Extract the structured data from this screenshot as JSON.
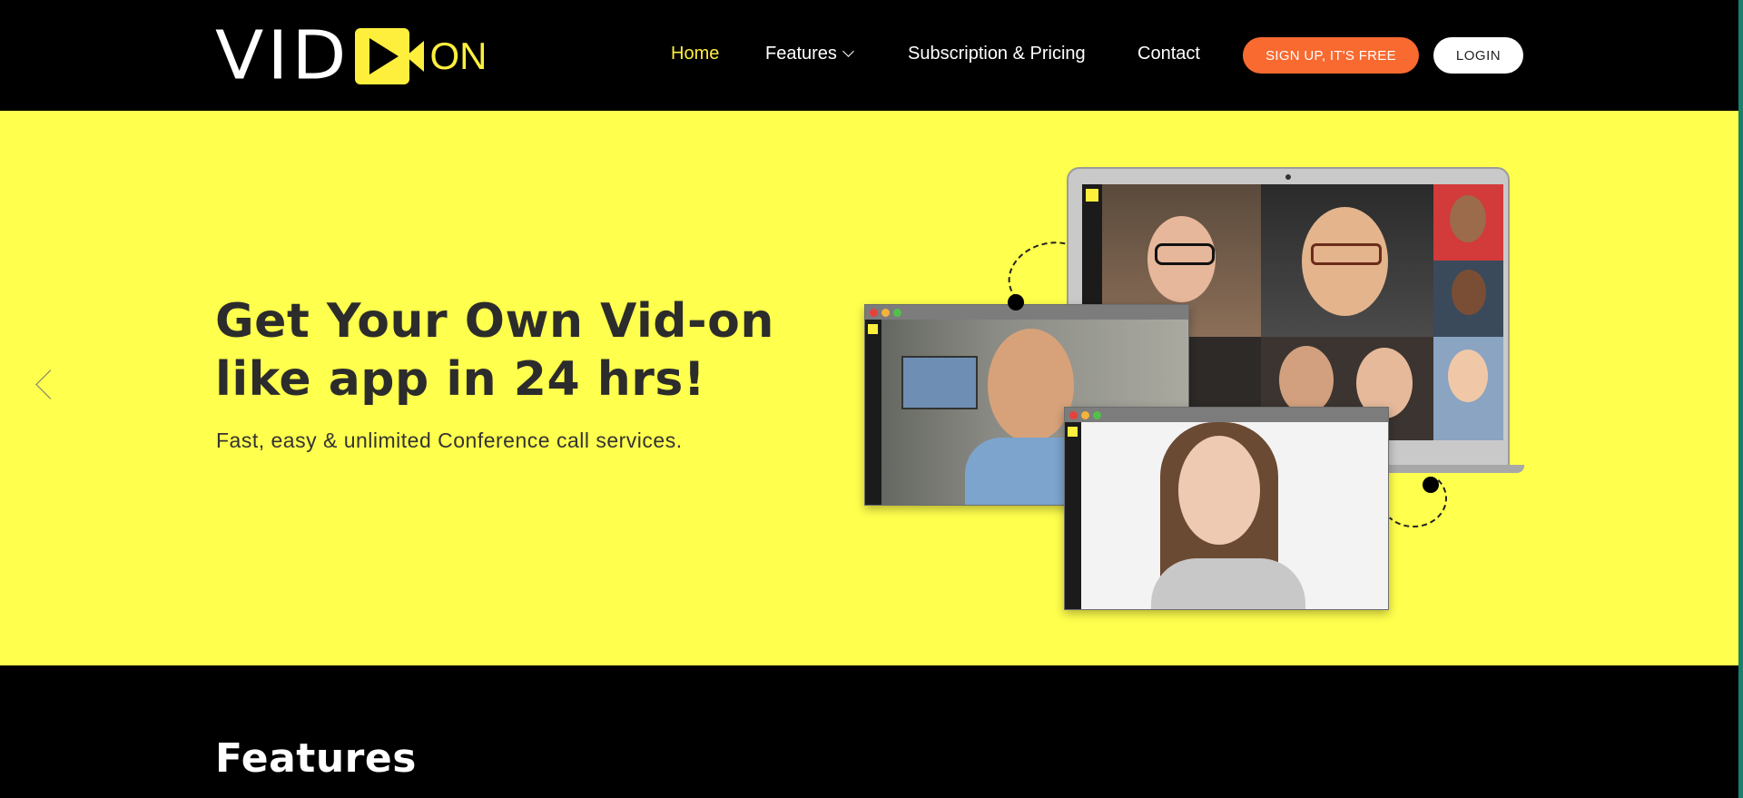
{
  "header": {
    "logo": {
      "part1": "VID",
      "part2": "ON"
    },
    "nav": [
      {
        "label": "Home",
        "active": true
      },
      {
        "label": "Features"
      },
      {
        "label": "Subscription & Pricing"
      },
      {
        "label": "Contact"
      }
    ],
    "signup_label": "SIGN UP, IT'S FREE",
    "login_label": "LOGIN"
  },
  "hero": {
    "title": "Get Your Own Vid-on like app in 24 hrs!",
    "subtitle": "Fast, easy & unlimited Conference call services.",
    "prev_icon": "chevron-left-icon"
  },
  "features": {
    "title": "Features"
  },
  "colors": {
    "brand_yellow": "#ffef3d",
    "hero_bg": "#ffff4d",
    "signup_orange": "#f86a30",
    "header_bg": "#000000"
  }
}
